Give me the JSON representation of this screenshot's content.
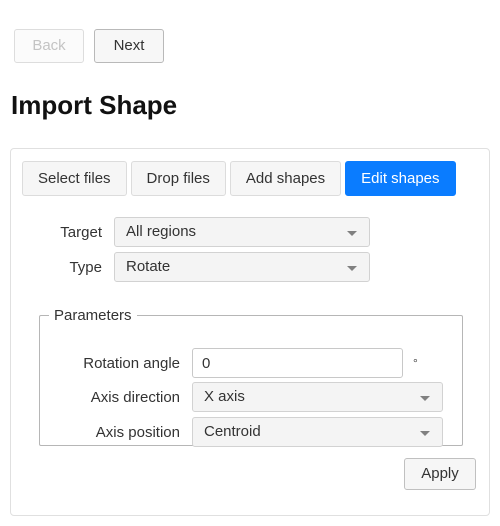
{
  "nav": {
    "back_label": "Back",
    "next_label": "Next"
  },
  "page": {
    "title": "Import Shape"
  },
  "tabs": [
    {
      "label": "Select files",
      "active": false
    },
    {
      "label": "Drop files",
      "active": false
    },
    {
      "label": "Add shapes",
      "active": false
    },
    {
      "label": "Edit shapes",
      "active": true
    }
  ],
  "form": {
    "target": {
      "label": "Target",
      "value": "All regions"
    },
    "type": {
      "label": "Type",
      "value": "Rotate"
    }
  },
  "parameters": {
    "legend": "Parameters",
    "rotation_angle": {
      "label": "Rotation angle",
      "value": "0",
      "unit": "°"
    },
    "axis_direction": {
      "label": "Axis direction",
      "value": "X axis"
    },
    "axis_position": {
      "label": "Axis position",
      "value": "Centroid"
    }
  },
  "actions": {
    "apply_label": "Apply"
  },
  "colors": {
    "accent": "#0a7cff",
    "panel_border": "#e0e0e0",
    "field_bg": "#f4f4f4"
  }
}
